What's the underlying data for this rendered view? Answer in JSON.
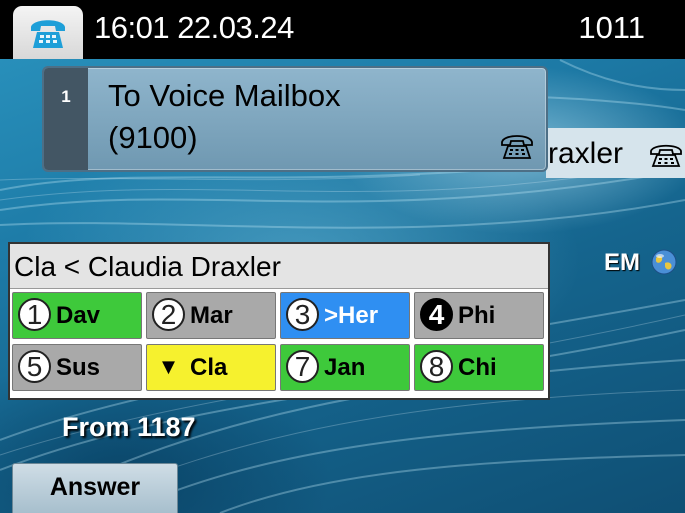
{
  "status_bar": {
    "time_date": "16:01 22.03.24",
    "extension": "1011",
    "phone_icon": "phone-icon"
  },
  "call_popup": {
    "index": "1",
    "line1": "To Voice Mailbox",
    "line2": "(9100)",
    "icon": "phone-icon"
  },
  "line_label": {
    "text": "raxler",
    "icon": "phone-icon"
  },
  "em_indicator": {
    "label": "EM",
    "icon": "globe-icon"
  },
  "speed_dial": {
    "header": "Cla < Claudia Draxler",
    "buttons": [
      {
        "num": "1",
        "label": "Dav",
        "color": "#3ec93b",
        "style": "outline",
        "text": "dark"
      },
      {
        "num": "2",
        "label": "Mar",
        "color": "#a9a9a9",
        "style": "outline",
        "text": "dark"
      },
      {
        "num": "3",
        "label": ">Her",
        "color": "#2f8ff2",
        "style": "outline",
        "text": "light"
      },
      {
        "num": "4",
        "label": "Phi",
        "color": "#a9a9a9",
        "style": "filled",
        "text": "dark"
      },
      {
        "num": "5",
        "label": "Sus",
        "color": "#a9a9a9",
        "style": "outline",
        "text": "dark"
      },
      {
        "num": "▼",
        "label": "Cla",
        "color": "#f6f12e",
        "style": "arrow",
        "text": "dark"
      },
      {
        "num": "7",
        "label": "Jan",
        "color": "#3ec93b",
        "style": "outline",
        "text": "dark"
      },
      {
        "num": "8",
        "label": "Chi",
        "color": "#3ec93b",
        "style": "outline",
        "text": "dark"
      }
    ]
  },
  "incoming": {
    "from_text": "From 1187"
  },
  "softkeys": {
    "answer_label": "Answer"
  }
}
